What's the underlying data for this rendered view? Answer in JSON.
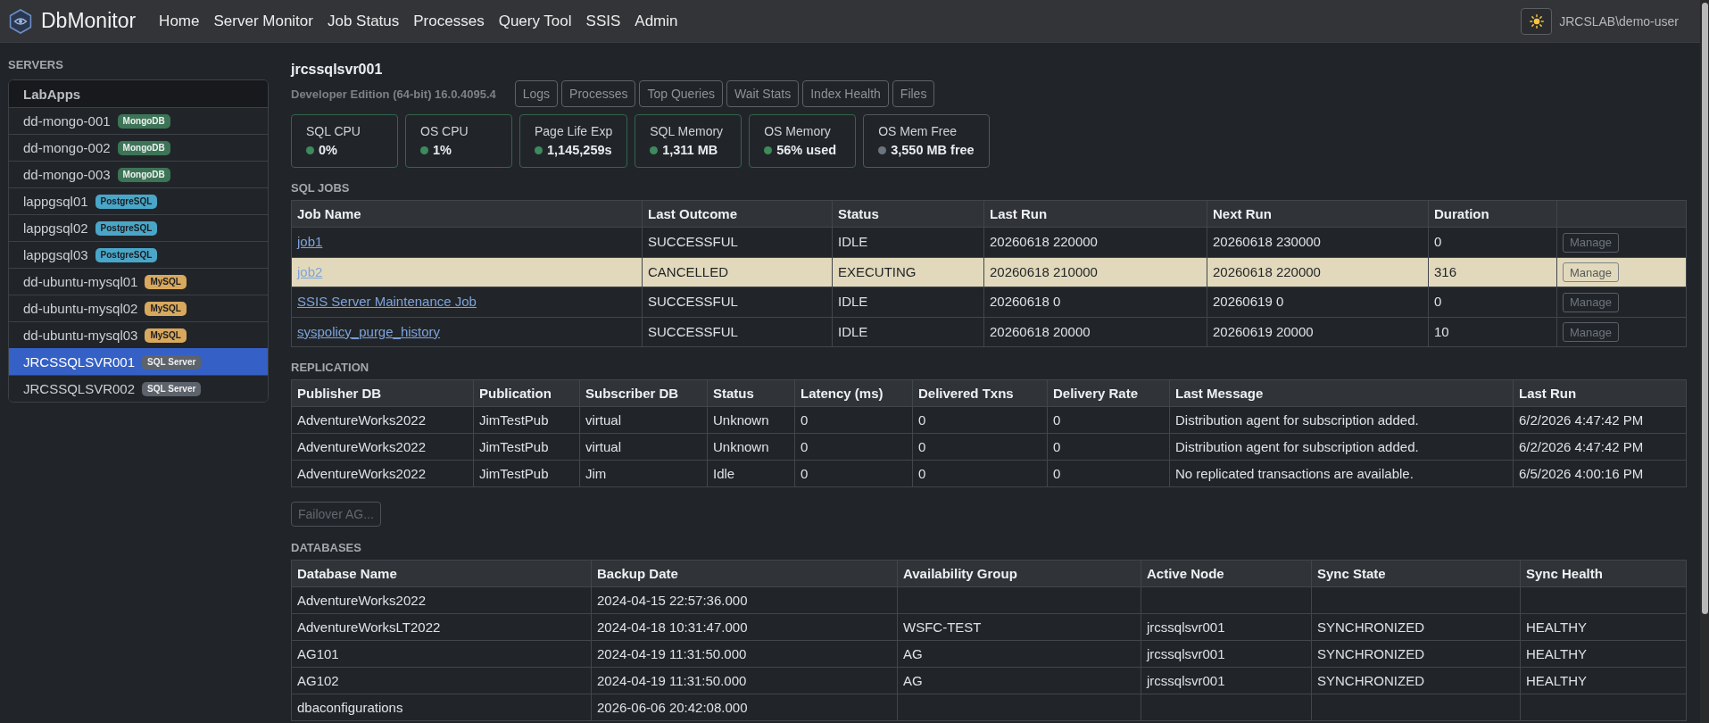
{
  "navbar": {
    "brand": "DbMonitor",
    "links": [
      "Home",
      "Server Monitor",
      "Job Status",
      "Processes",
      "Query Tool",
      "SSIS",
      "Admin"
    ],
    "user": "JRCSLAB\\demo-user"
  },
  "sidebar": {
    "title": "SERVERS",
    "groups": [
      {
        "name": "LabApps",
        "servers": [
          {
            "name": "dd-mongo-001",
            "badge": "MongoDB",
            "color": "#3d7456",
            "selected": false
          },
          {
            "name": "dd-mongo-002",
            "badge": "MongoDB",
            "color": "#3d7456",
            "selected": false
          },
          {
            "name": "dd-mongo-003",
            "badge": "MongoDB",
            "color": "#3d7456",
            "selected": false
          },
          {
            "name": "lappgsql01",
            "badge": "PostgreSQL",
            "color": "#4aa6c8",
            "selected": false
          },
          {
            "name": "lappgsql02",
            "badge": "PostgreSQL",
            "color": "#4aa6c8",
            "selected": false
          },
          {
            "name": "lappgsql03",
            "badge": "PostgreSQL",
            "color": "#4aa6c8",
            "selected": false
          },
          {
            "name": "dd-ubuntu-mysql01",
            "badge": "MySQL",
            "color": "#d8a85e",
            "selected": false
          },
          {
            "name": "dd-ubuntu-mysql02",
            "badge": "MySQL",
            "color": "#d8a85e",
            "selected": false
          },
          {
            "name": "dd-ubuntu-mysql03",
            "badge": "MySQL",
            "color": "#d8a85e",
            "selected": false
          },
          {
            "name": "JRCSSQLSVR001",
            "badge": "SQL Server",
            "color": "#5c636a",
            "selected": true
          },
          {
            "name": "JRCSSQLSVR002",
            "badge": "SQL Server",
            "color": "#5c636a",
            "selected": false
          }
        ]
      }
    ]
  },
  "server": {
    "title": "jrcssqlsvr001",
    "edition": "Developer Edition (64-bit) 16.0.4095.4",
    "buttons": [
      "Logs",
      "Processes",
      "Top Queries",
      "Wait Stats",
      "Index Health",
      "Files"
    ]
  },
  "metrics": [
    {
      "label": "SQL CPU",
      "value": "0%",
      "color": "#3e8a5c"
    },
    {
      "label": "OS CPU",
      "value": "1%",
      "color": "#3e8a5c"
    },
    {
      "label": "Page Life Exp",
      "value": "1,145,259s",
      "color": "#3e8a5c"
    },
    {
      "label": "SQL Memory",
      "value": "1,311 MB",
      "color": "#3e8a5c"
    },
    {
      "label": "OS Memory",
      "value": "56% used",
      "color": "#3e8a5c"
    },
    {
      "label": "OS Mem Free",
      "value": "3,550 MB free",
      "color": "#6c757d"
    }
  ],
  "sql_jobs": {
    "title": "SQL JOBS",
    "columns": [
      "Job Name",
      "Last Outcome",
      "Status",
      "Last Run",
      "Next Run",
      "Duration"
    ],
    "rows": [
      {
        "cells": [
          "job1",
          "SUCCESSFUL",
          "IDLE",
          "20260618 220000",
          "20260618 230000",
          "0"
        ],
        "action": {
          "label": "Manage",
          "disabled": true
        },
        "highlighted": false
      },
      {
        "cells": [
          "job2",
          "CANCELLED",
          "EXECUTING",
          "20260618 210000",
          "20260618 220000",
          "316"
        ],
        "action": {
          "label": "Manage",
          "disabled": true
        },
        "highlighted": true
      },
      {
        "cells": [
          "SSIS Server Maintenance Job",
          "SUCCESSFUL",
          "IDLE",
          "20260618 0",
          "20260619 0",
          "0"
        ],
        "action": {
          "label": "Manage",
          "disabled": true
        },
        "highlighted": false
      },
      {
        "cells": [
          "syspolicy_purge_history",
          "SUCCESSFUL",
          "IDLE",
          "20260618 20000",
          "20260619 20000",
          "10"
        ],
        "action": {
          "label": "Manage",
          "disabled": true
        },
        "highlighted": false
      }
    ]
  },
  "replication": {
    "title": "REPLICATION",
    "columns": [
      "Publisher DB",
      "Publication",
      "Subscriber DB",
      "Status",
      "Latency (ms)",
      "Delivered Txns",
      "Delivery Rate",
      "Last Message",
      "Last Run"
    ],
    "rows": [
      [
        "AdventureWorks2022",
        "JimTestPub",
        "virtual",
        "Unknown",
        "0",
        "0",
        "0",
        "Distribution agent for subscription added.",
        "6/2/2026 4:47:42 PM"
      ],
      [
        "AdventureWorks2022",
        "JimTestPub",
        "virtual",
        "Unknown",
        "0",
        "0",
        "0",
        "Distribution agent for subscription added.",
        "6/2/2026 4:47:42 PM"
      ],
      [
        "AdventureWorks2022",
        "JimTestPub",
        "Jim",
        "Idle",
        "0",
        "0",
        "0",
        "No replicated transactions are available.",
        "6/5/2026 4:00:16 PM"
      ]
    ]
  },
  "failover_button": {
    "label": "Failover AG...",
    "disabled": true
  },
  "databases": {
    "title": "DATABASES",
    "columns": [
      "Database Name",
      "Backup Date",
      "Availability Group",
      "Active Node",
      "Sync State",
      "Sync Health"
    ],
    "rows": [
      [
        "AdventureWorks2022",
        "2024-04-15 22:57:36.000",
        null,
        null,
        null,
        null
      ],
      [
        "AdventureWorksLT2022",
        "2024-04-18 10:31:47.000",
        "WSFC-TEST",
        "jrcssqlsvr001",
        "SYNCHRONIZED",
        "HEALTHY"
      ],
      [
        "AG101",
        "2024-04-19 11:31:50.000",
        "AG",
        "jrcssqlsvr001",
        "SYNCHRONIZED",
        "HEALTHY"
      ],
      [
        "AG102",
        "2024-04-19 11:31:50.000",
        "AG",
        "jrcssqlsvr001",
        "SYNCHRONIZED",
        "HEALTHY"
      ],
      [
        "dbaconfigurations",
        "2026-06-06 20:42:08.000",
        null,
        null,
        null,
        null
      ]
    ]
  }
}
